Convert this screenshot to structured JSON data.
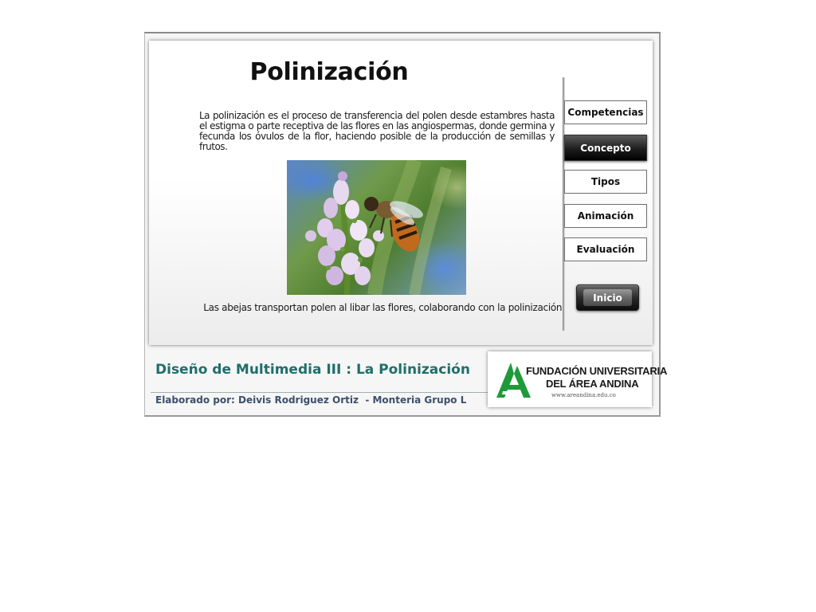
{
  "page": {
    "title": "Polinización",
    "intro": "La polinización es el proceso de transferencia del polen desde estambres hasta el estigma o parte receptiva de las flores en las angiospermas, donde germina y fecunda los óvulos de la flor, haciendo posible de la producción de semillas y frutos.",
    "caption": "Las abejas transportan polen al libar las flores, colaborando con la polinización."
  },
  "nav": {
    "items": [
      {
        "label": "Competencias",
        "active": false
      },
      {
        "label": "Concepto",
        "active": true
      },
      {
        "label": "Tipos",
        "active": false
      },
      {
        "label": "Animación",
        "active": false
      },
      {
        "label": "Evaluación",
        "active": false
      }
    ],
    "home_label": "Inicio"
  },
  "footer": {
    "course_title": "Diseño de Multimedia III : La Polinización",
    "credits": "Elaborado por: Deivis Rodriguez Ortiz  - Monteria Grupo L"
  },
  "logo": {
    "line1": "FUNDACIÓN UNIVERSITARIA",
    "line2": "DEL ÁREA ANDINA",
    "url": "www.areandina.edu.co"
  },
  "colors": {
    "footer_title": "#1d6f6a",
    "footer_credits": "#3c4f6c",
    "logo_green": "#1f9a3a",
    "active_button": "#1d1d1d"
  },
  "icons": {
    "logo_mark": "andina-a-logo-icon",
    "photo": "bee-on-flower-photo"
  }
}
